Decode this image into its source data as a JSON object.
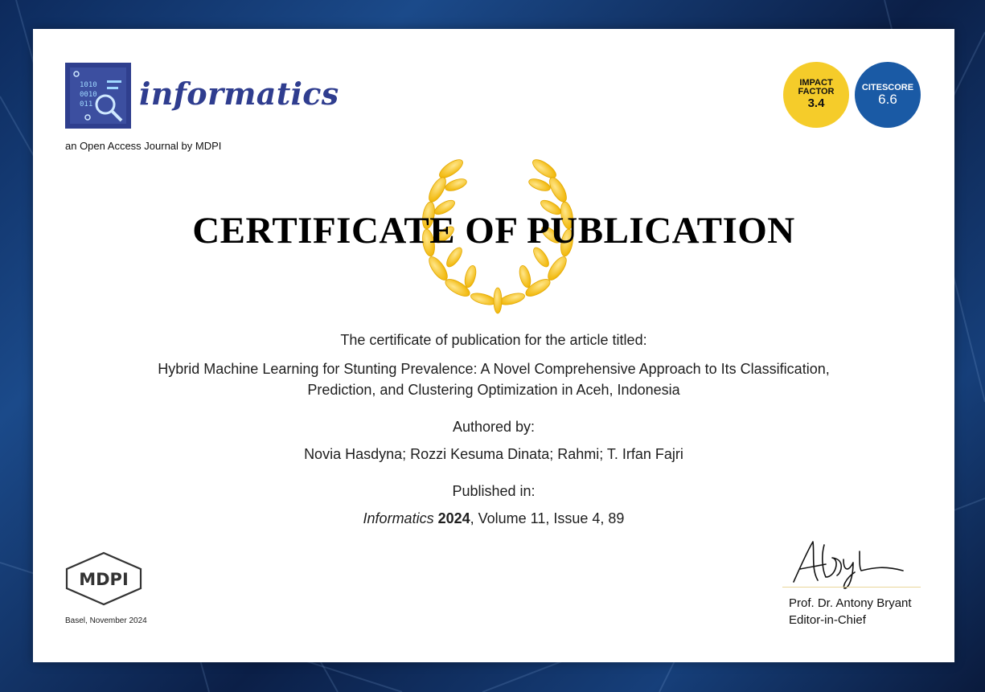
{
  "journal": {
    "name": "informatics",
    "subtitle": "an Open Access Journal by MDPI"
  },
  "badges": {
    "impact_factor_label": "IMPACT FACTOR",
    "impact_factor_value": "3.4",
    "citescore_label": "CITESCORE",
    "citescore_value": "6.6"
  },
  "certificate": {
    "title": "CERTIFICATE OF PUBLICATION",
    "intro": "The certificate of publication for the article titled:",
    "article_title_line1": "Hybrid Machine Learning for Stunting Prevalence: A Novel Comprehensive Approach to Its Classification,",
    "article_title_line2": "Prediction, and Clustering Optimization in Aceh, Indonesia",
    "authored_label": "Authored by:",
    "authors": "Novia Hasdyna; Rozzi Kesuma Dinata; Rahmi; T. Irfan Fajri",
    "published_label": "Published in:",
    "journal_italic": "Informatics",
    "year": "2024",
    "citation_rest": ", Volume 11, Issue 4, 89"
  },
  "footer": {
    "publisher_logo_text": "MDPI",
    "place_date": "Basel, November 2024",
    "editor_name": "Prof. Dr. Antony Bryant",
    "editor_role": "Editor-in-Chief"
  },
  "colors": {
    "journal_blue": "#2f3d8f",
    "impact_yellow": "#f5cc2a",
    "citescore_blue": "#1a5aa5",
    "laurel_gold": "#f6c21c",
    "background_navy": "#0d2a5c"
  }
}
